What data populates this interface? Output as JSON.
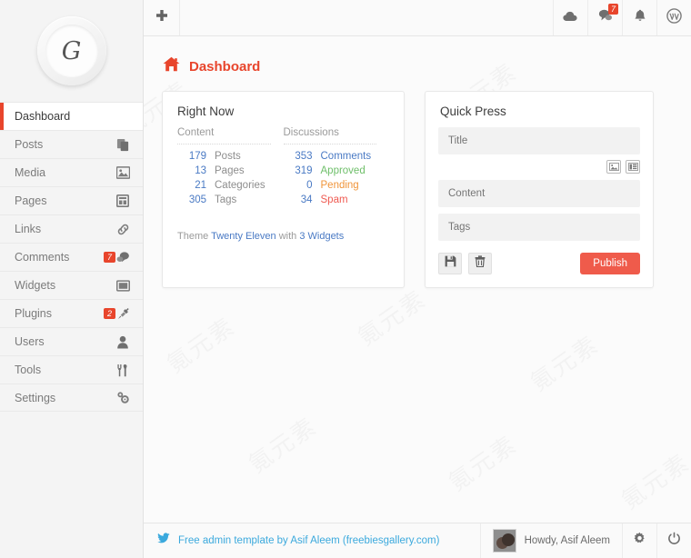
{
  "sidebar": {
    "logo_glyph": "G",
    "items": [
      {
        "label": "Dashboard",
        "icon": "",
        "active": true,
        "badge": ""
      },
      {
        "label": "Posts",
        "icon": "posts-icon",
        "active": false,
        "badge": ""
      },
      {
        "label": "Media",
        "icon": "media-icon",
        "active": false,
        "badge": ""
      },
      {
        "label": "Pages",
        "icon": "pages-icon",
        "active": false,
        "badge": ""
      },
      {
        "label": "Links",
        "icon": "link-icon",
        "active": false,
        "badge": ""
      },
      {
        "label": "Comments",
        "icon": "comment-icon",
        "active": false,
        "badge": "7"
      },
      {
        "label": "Widgets",
        "icon": "widget-icon",
        "active": false,
        "badge": ""
      },
      {
        "label": "Plugins",
        "icon": "plugin-icon",
        "active": false,
        "badge": "2"
      },
      {
        "label": "Users",
        "icon": "user-icon",
        "active": false,
        "badge": ""
      },
      {
        "label": "Tools",
        "icon": "tools-icon",
        "active": false,
        "badge": ""
      },
      {
        "label": "Settings",
        "icon": "settings-icon",
        "active": false,
        "badge": ""
      }
    ]
  },
  "topbar": {
    "add_icon": "plus-icon",
    "buttons": [
      {
        "icon": "cloud-icon",
        "badge": ""
      },
      {
        "icon": "comments-icon",
        "badge": "7"
      },
      {
        "icon": "bell-icon",
        "badge": ""
      },
      {
        "icon": "wordpress-icon",
        "badge": ""
      }
    ]
  },
  "page": {
    "title": "Dashboard",
    "title_icon": "home-icon",
    "accent_color": "#e8452c"
  },
  "right_now": {
    "title": "Right Now",
    "content_heading": "Content",
    "discussions_heading": "Discussions",
    "content_rows": [
      {
        "count": "179",
        "label": "Posts"
      },
      {
        "count": "13",
        "label": "Pages"
      },
      {
        "count": "21",
        "label": "Categories"
      },
      {
        "count": "305",
        "label": "Tags"
      }
    ],
    "discussion_rows": [
      {
        "count": "353",
        "label": "Comments",
        "style": "lnk"
      },
      {
        "count": "319",
        "label": "Approved",
        "style": "ok"
      },
      {
        "count": "0",
        "label": "Pending",
        "style": "warn"
      },
      {
        "count": "34",
        "label": "Spam",
        "style": "bad"
      }
    ],
    "footer_prefix": "Theme ",
    "footer_theme": "Twenty Eleven",
    "footer_middle": " with ",
    "footer_widgets": "3 Widgets"
  },
  "quick_press": {
    "title": "Quick Press",
    "title_placeholder": "Title",
    "content_placeholder": "Content",
    "tags_placeholder": "Tags",
    "title_value": "",
    "content_value": "",
    "tags_value": "",
    "media_image_icon": "insert-image-icon",
    "media_gallery_icon": "insert-gallery-icon",
    "save_icon": "save-icon",
    "delete_icon": "trash-icon",
    "publish_label": "Publish",
    "publish_color": "#ef5b4b"
  },
  "footer": {
    "twitter_icon": "twitter-icon",
    "credit_text": "Free admin template by Asif Aleem (freebiesgallery.com)",
    "user_greeting": "Howdy, Asif Aleem",
    "avatar": "user-avatar",
    "settings_icon": "gear-icon",
    "logout_icon": "power-icon"
  },
  "watermark": {
    "text": "氪元素"
  }
}
